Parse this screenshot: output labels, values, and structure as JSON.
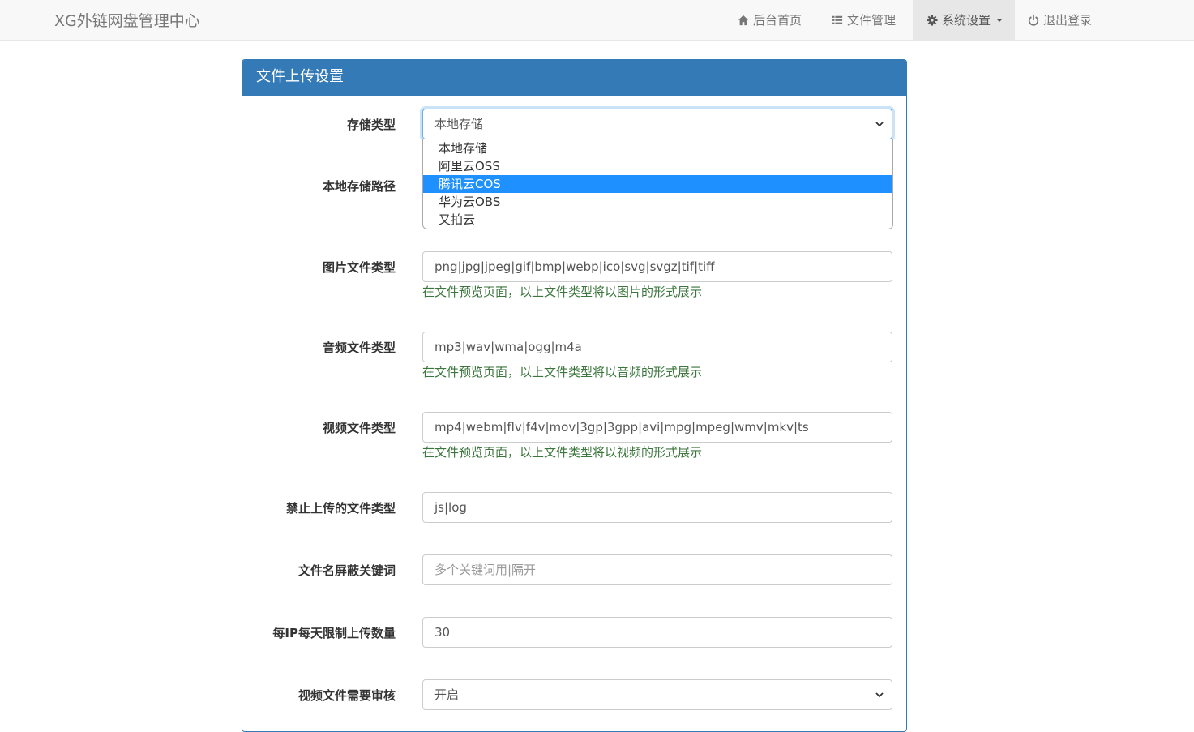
{
  "nav": {
    "brand": "XG外链网盘管理中心",
    "items": [
      {
        "label": "后台首页",
        "icon": "home-icon"
      },
      {
        "label": "文件管理",
        "icon": "list-icon"
      },
      {
        "label": "系统设置",
        "icon": "gear-icon",
        "active": true
      },
      {
        "label": "退出登录",
        "icon": "power-icon"
      }
    ]
  },
  "panel": {
    "title": "文件上传设置"
  },
  "form": {
    "storage_type": {
      "label": "存储类型",
      "value": "本地存储"
    },
    "local_path": {
      "label": "本地存储路径"
    },
    "image_types": {
      "label": "图片文件类型",
      "value": "png|jpg|jpeg|gif|bmp|webp|ico|svg|svgz|tif|tiff",
      "help": "在文件预览页面，以上文件类型将以图片的形式展示"
    },
    "audio_types": {
      "label": "音频文件类型",
      "value": "mp3|wav|wma|ogg|m4a",
      "help": "在文件预览页面，以上文件类型将以音频的形式展示"
    },
    "video_types": {
      "label": "视频文件类型",
      "value": "mp4|webm|flv|f4v|mov|3gp|3gpp|avi|mpg|mpeg|wmv|mkv|ts",
      "help": "在文件预览页面，以上文件类型将以视频的形式展示"
    },
    "banned_types": {
      "label": "禁止上传的文件类型",
      "value": "js|log"
    },
    "keywords": {
      "label": "文件名屏蔽关键词",
      "placeholder": "多个关键词用|隔开"
    },
    "ip_limit": {
      "label": "每IP每天限制上传数量",
      "value": "30"
    },
    "video_review": {
      "label": "视频文件需要审核",
      "value": "开启"
    }
  },
  "dropdown": {
    "options": [
      "本地存储",
      "阿里云OSS",
      "腾讯云COS",
      "华为云OBS",
      "又拍云"
    ],
    "highlighted": "腾讯云COS"
  },
  "colors": {
    "primary": "#337ab7",
    "help": "#3c763d",
    "highlight": "#1e90ff"
  }
}
